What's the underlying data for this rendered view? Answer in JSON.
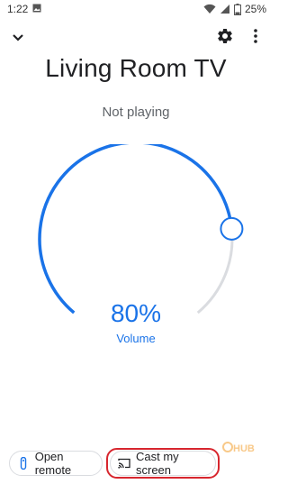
{
  "status_bar": {
    "time": "1:22",
    "battery": "25%",
    "icons": [
      "gallery-icon",
      "wifi-icon",
      "signal-icon",
      "battery-icon"
    ]
  },
  "header": {
    "collapse_icon": "chevron-down-icon",
    "settings_icon": "gear-icon",
    "more_icon": "more-vert-icon"
  },
  "device": {
    "name": "Living Room TV",
    "playback_status": "Not playing"
  },
  "volume": {
    "percent_label": "80%",
    "label": "Volume",
    "level": 0.8,
    "accent_color": "#1a73e8",
    "track_color": "#dadce0"
  },
  "actions": {
    "open_remote": "Open remote",
    "cast_my_screen": "Cast my screen",
    "highlight_color": "#d7262e"
  },
  "watermark": {
    "text": "HUB"
  }
}
